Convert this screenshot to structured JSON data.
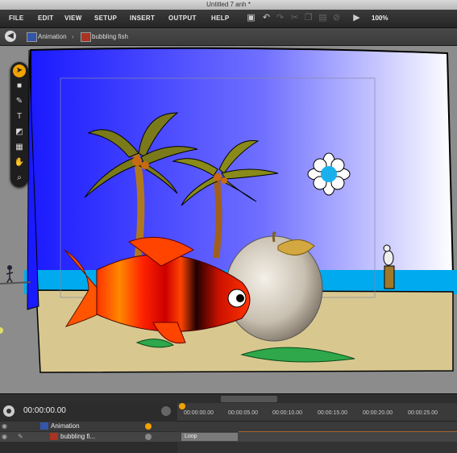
{
  "window": {
    "title": "Untitled 7 anh *"
  },
  "menu": [
    "FILE",
    "EDIT",
    "VIEW",
    "SETUP",
    "INSERT",
    "OUTPUT",
    "HELP"
  ],
  "toolbar": {
    "zoom": "100%"
  },
  "breadcrumb": {
    "item1": "Animation",
    "item2": "bubbling fish"
  },
  "timeline": {
    "time": "00:00:00.00",
    "ticks": [
      "00:00:00.00",
      "00:00:05.00",
      "00:00:10.00",
      "00:00:15.00",
      "00:00:20.00",
      "00:00:25.00"
    ],
    "layers": [
      {
        "name": "Animation"
      },
      {
        "name": "bubbling fi..."
      }
    ],
    "track_label": "Loop"
  },
  "colors": {
    "accent": "#f1a200",
    "sky": "#2020ff",
    "sea": "#00aaee",
    "sand": "#d8c890"
  }
}
